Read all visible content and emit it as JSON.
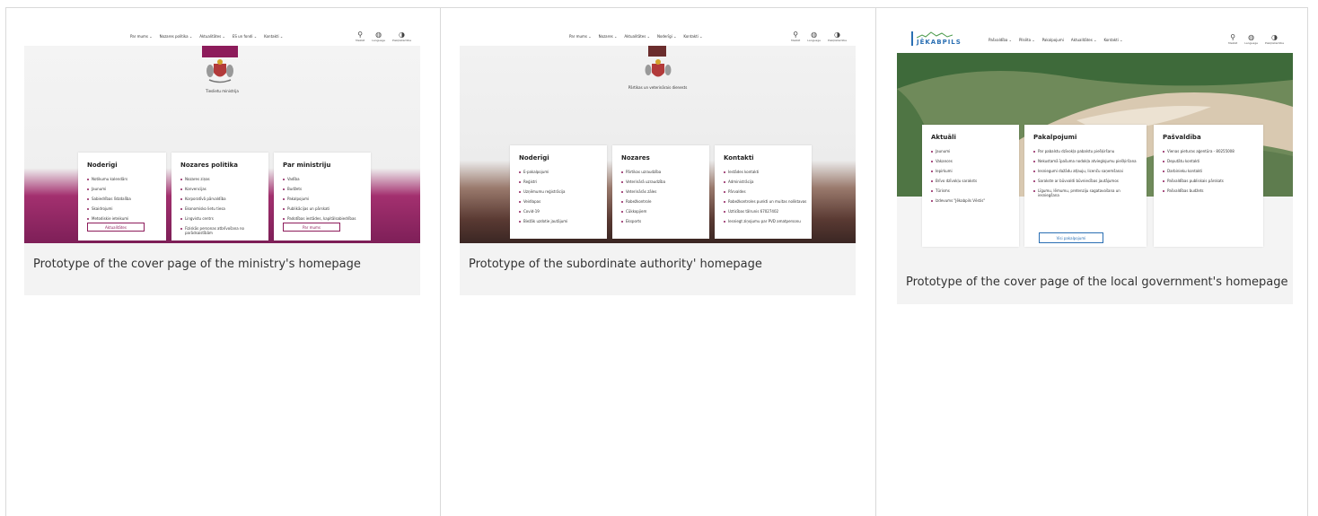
{
  "cards": [
    {
      "caption": "Prototype of the cover page of the ministry's homepage",
      "nav": [
        "Par mums ⌄",
        "Nozares politika ⌄",
        "Aktualitātes ⌄",
        "ES un fondi ⌄",
        "Kontakti ⌄"
      ],
      "tools": [
        {
          "icon": "search-icon",
          "glyph": "⚲",
          "label": "Meklēt"
        },
        {
          "icon": "globe-icon",
          "glyph": "◍",
          "label": "Language"
        },
        {
          "icon": "accessibility-icon",
          "glyph": "◑",
          "label": "Piekļūstamība"
        }
      ],
      "brand": "Tieslietu ministrija",
      "accent": "#8d1c5b",
      "panels": [
        {
          "title": "Noderīgi",
          "items": [
            "Notikumu kalendārs",
            "Jaunumi",
            "Sabiedrības līdzdalība",
            "Skaidrojumi",
            "Metodiskie ieteikumi"
          ],
          "button": "Aktualitātes"
        },
        {
          "title": "Nozares politika",
          "items": [
            "Nozares ziņas",
            "Konvencijas",
            "Korporatīvā pārvaldība",
            "Ekonomisko lietu tiesa",
            "Lingvistu centrs",
            "Fiziskās personas atbrīvošana no parādsaistībām"
          ]
        },
        {
          "title": "Par ministriju",
          "items": [
            "Vadība",
            "Budžets",
            "Pakalpojumi",
            "Publikācijas un pārskati",
            "Padotības iestādes, kapitālsabiedrības"
          ],
          "button": "Par mums"
        }
      ]
    },
    {
      "caption": "Prototype of the subordinate authority' homepage",
      "nav": [
        "Par mums ⌄",
        "Nozares ⌄",
        "Aktualitātes ⌄",
        "Noderīgi ⌄",
        "Kontakti ⌄"
      ],
      "tools": [
        {
          "icon": "search-icon",
          "glyph": "⚲",
          "label": "Meklēt"
        },
        {
          "icon": "globe-icon",
          "glyph": "◍",
          "label": "Language"
        },
        {
          "icon": "accessibility-icon",
          "glyph": "◑",
          "label": "Piekļūstamība"
        }
      ],
      "brand": "Pārtikas un veterinārais dienests",
      "accent": "#6b2d2d",
      "panels": [
        {
          "title": "Noderīgi",
          "items": [
            "E-pakalpojumi",
            "Reģistri",
            "Uzņēmumu reģistrācija",
            "Veidlapas",
            "Covid-19",
            "Biežāk uzdotie jautājumi"
          ]
        },
        {
          "title": "Nozares",
          "items": [
            "Pārtikas uzraudzība",
            "Veterinārā uzraudzība",
            "Veterinārās zāles",
            "Robežkontrole",
            "Cūkkopjiem",
            "Eksports"
          ]
        },
        {
          "title": "Kontakti",
          "items": [
            "Iestādes kontakti",
            "Administrācija",
            "Pārvaldes",
            "Robežkontroles punkti un muitas noliktavas",
            "Uzticības tālrunis 67027402",
            "Iesniegt ziņojumu par PVD amatpersonu"
          ]
        }
      ]
    },
    {
      "caption": "Prototype of the cover page of the local government's homepage",
      "logo": "JĒKABPILS",
      "nav": [
        "Pašvaldība ⌄",
        "Pilsēta ⌄",
        "Pakalpojumi",
        "Aktualitātes ⌄",
        "Kontakti ⌄"
      ],
      "tools": [
        {
          "icon": "search-icon",
          "glyph": "⚲",
          "label": "Meklēt"
        },
        {
          "icon": "globe-icon",
          "glyph": "◍",
          "label": "Language"
        },
        {
          "icon": "accessibility-icon",
          "glyph": "◑",
          "label": "Piekļūstamība"
        }
      ],
      "accent": "#2a6fb3",
      "panels": [
        {
          "title": "Aktuāli",
          "items": [
            "Jaunumi",
            "Vakances",
            "Iepirkumi",
            "Brīvo dzīvokļu saraksts",
            "Tūrisms",
            "Izdevums \"Jēkabpils Vēstis\""
          ]
        },
        {
          "title": "Pakalpojumi",
          "items": [
            "Par pabalstu dzīvokļa pabalstu piešķiršanu",
            "Nekustamā īpašuma nodokļa atvieglojumu piešķiršana",
            "Iesniegumi dažādu atļauju, licenču saņemšanai",
            "Sarakste ar būvvaldi būvniecības jautājumos",
            "Līgumu, lēmumu, pretenziju sagatavošana un iesniegšana"
          ],
          "button": "Visi pakalpojumi"
        },
        {
          "title": "Pašvaldība",
          "items": [
            "Vienas pieturas aģentūra - 80255008",
            "Deputātu kontakti",
            "Darbinieku kontakti",
            "Pašvaldības publiskais pārskats",
            "Pašvaldības budžets"
          ]
        }
      ]
    }
  ]
}
